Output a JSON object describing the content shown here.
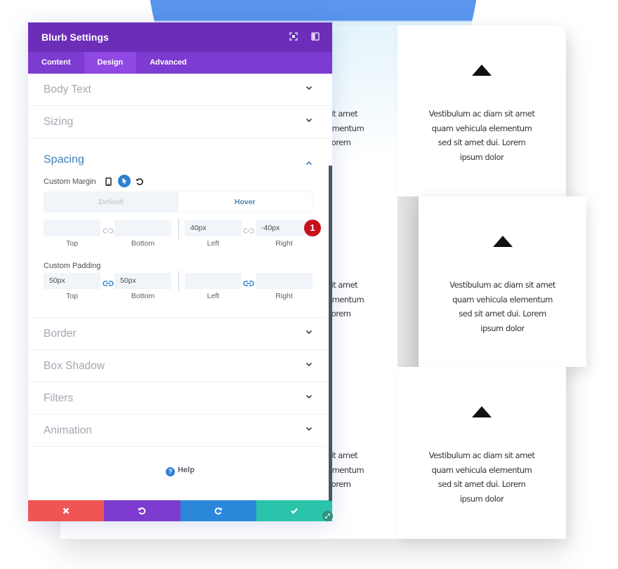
{
  "panel": {
    "title": "Blurb Settings",
    "header_icons": [
      "focus-icon",
      "sidebar-layout-icon"
    ],
    "tabs": [
      {
        "label": "Content",
        "active": false
      },
      {
        "label": "Design",
        "active": true
      },
      {
        "label": "Advanced",
        "active": false
      }
    ],
    "sections_top": [
      {
        "label": "Body Text",
        "expanded": false
      },
      {
        "label": "Sizing",
        "expanded": false
      }
    ],
    "spacing": {
      "label": "Spacing",
      "expanded": true,
      "custom_margin": {
        "label": "Custom Margin",
        "icons": [
          "mobile-icon",
          "cursor-hover-icon",
          "reset-icon"
        ],
        "states": {
          "default": "Default",
          "hover": "Hover",
          "active": "Hover"
        },
        "fields": [
          {
            "label": "Top",
            "value": ""
          },
          {
            "label": "Bottom",
            "value": ""
          },
          {
            "label": "Left",
            "value": "40px"
          },
          {
            "label": "Right",
            "value": "-40px"
          }
        ],
        "linked": false
      },
      "custom_padding": {
        "label": "Custom Padding",
        "fields": [
          {
            "label": "Top",
            "value": "50px"
          },
          {
            "label": "Bottom",
            "value": "50px"
          },
          {
            "label": "Left",
            "value": ""
          },
          {
            "label": "Right",
            "value": ""
          }
        ],
        "linked": true
      },
      "step_badge": "1"
    },
    "sections_bottom": [
      {
        "label": "Border",
        "expanded": false
      },
      {
        "label": "Box Shadow",
        "expanded": false
      },
      {
        "label": "Filters",
        "expanded": false
      },
      {
        "label": "Animation",
        "expanded": false
      }
    ],
    "help_label": "Help",
    "footer_buttons": [
      {
        "name": "cancel",
        "icon": "close-icon",
        "color": "#ef5555"
      },
      {
        "name": "undo",
        "icon": "undo-icon",
        "color": "#7e3bd0"
      },
      {
        "name": "redo",
        "icon": "redo-icon",
        "color": "#2b87da"
      },
      {
        "name": "save",
        "icon": "check-icon",
        "color": "#29c4a9"
      }
    ]
  },
  "colors": {
    "header": "#6c2eb9",
    "tabs": "#7d3bd1",
    "tab_active": "#8f48e3",
    "accent_blue": "#3e7fb9",
    "badge_red": "#c8101d",
    "bg_circle": "#5a95ee"
  },
  "blurbs": [
    {
      "text": "Vestibulum ac diam sit amet quam vehicula elementum sed sit amet dui. Lorem ipsum dolor",
      "lines": [
        "Vestibulum ac diam sit amet",
        "quam vehicula elementum",
        "sed sit amet dui. Lorem",
        "ipsum dolor"
      ]
    },
    {
      "partial_lines": [
        "sit amet",
        "ementum",
        "Lorem",
        "."
      ]
    }
  ]
}
